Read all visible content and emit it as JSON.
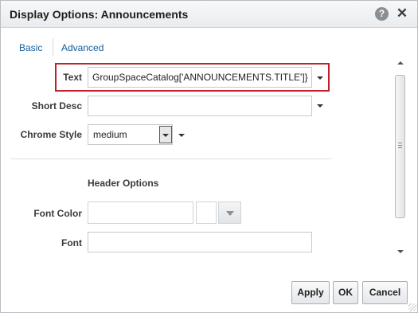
{
  "dialog": {
    "title": "Display Options: Announcements",
    "help_icon_glyph": "?",
    "close_icon_glyph": "✕"
  },
  "tabs": [
    {
      "label": "Basic",
      "selected": true
    },
    {
      "label": "Advanced",
      "selected": false
    }
  ],
  "form": {
    "text": {
      "label": "Text",
      "value": "GroupSpaceCatalog['ANNOUNCEMENTS.TITLE']}"
    },
    "short_desc": {
      "label": "Short Desc",
      "value": ""
    },
    "chrome_style": {
      "label": "Chrome Style",
      "value": "medium"
    },
    "header_options_title": "Header Options",
    "font_color": {
      "label": "Font Color",
      "value": ""
    },
    "font": {
      "label": "Font",
      "value": ""
    }
  },
  "buttons": {
    "apply": "Apply",
    "ok": "OK",
    "cancel": "Cancel"
  },
  "colors": {
    "highlight_border": "#c0202a",
    "tab_link": "#145c9e"
  }
}
